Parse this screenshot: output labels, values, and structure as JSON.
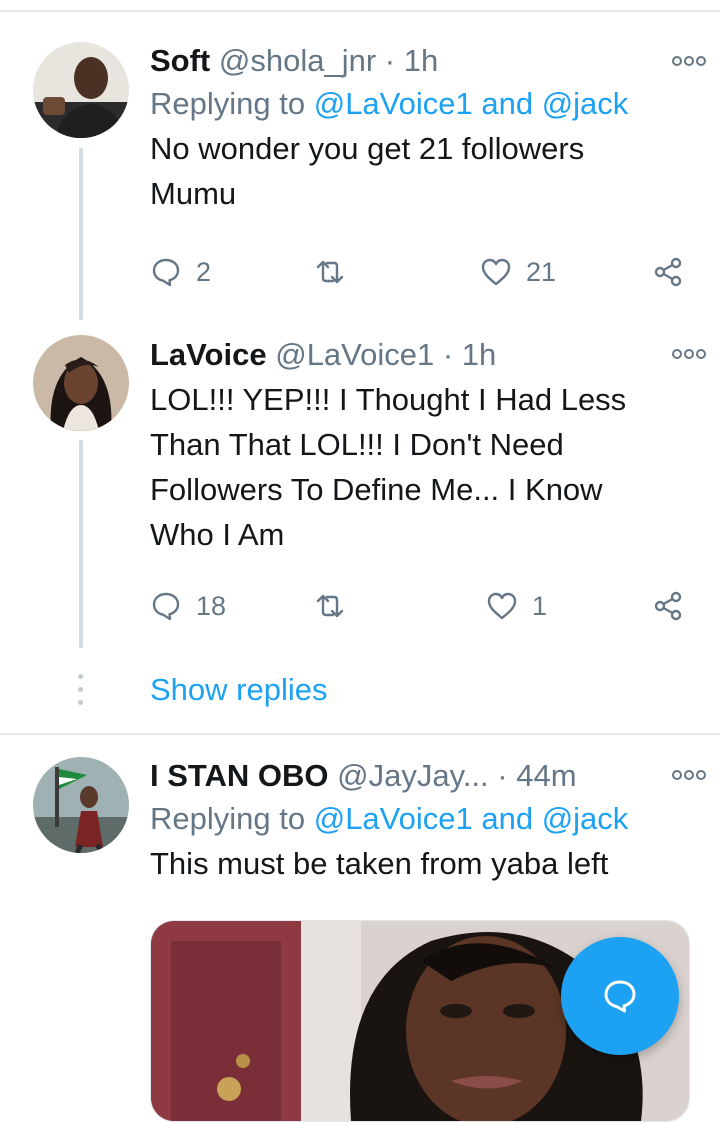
{
  "tweets": [
    {
      "name": "Soft",
      "handle": "@shola_jnr",
      "time": "· 1h",
      "replying_prefix": "Replying to",
      "replying_users": "@LaVoice1 and @jack",
      "text_lines": [
        "No wonder you get 21 followers",
        "Mumu"
      ],
      "reply_count": "2",
      "retweet_count": "",
      "like_count": "21"
    },
    {
      "name": "LaVoice",
      "handle": "@LaVoice1",
      "time": "· 1h",
      "text_lines": [
        "LOL!!! YEP!!! I Thought I Had Less",
        "Than That LOL!!! I Don't Need",
        "Followers To Define Me... I Know",
        "Who I Am"
      ],
      "reply_count": "18",
      "retweet_count": "",
      "like_count": "1"
    },
    {
      "name": "I STAN OBO",
      "handle": "@JayJay...",
      "time": "· 44m",
      "replying_prefix": "Replying to",
      "replying_users": "@LaVoice1 and @jack",
      "text_lines": [
        "This must be taken from yaba left"
      ]
    }
  ],
  "show_replies_label": "Show replies",
  "icons": {
    "more": "more-icon",
    "reply": "reply-icon",
    "retweet": "retweet-icon",
    "like": "heart-icon",
    "share": "share-icon",
    "compose": "compose-reply-icon"
  },
  "colors": {
    "accent": "#1da1f2",
    "muted": "#657786",
    "text": "#14171a"
  }
}
